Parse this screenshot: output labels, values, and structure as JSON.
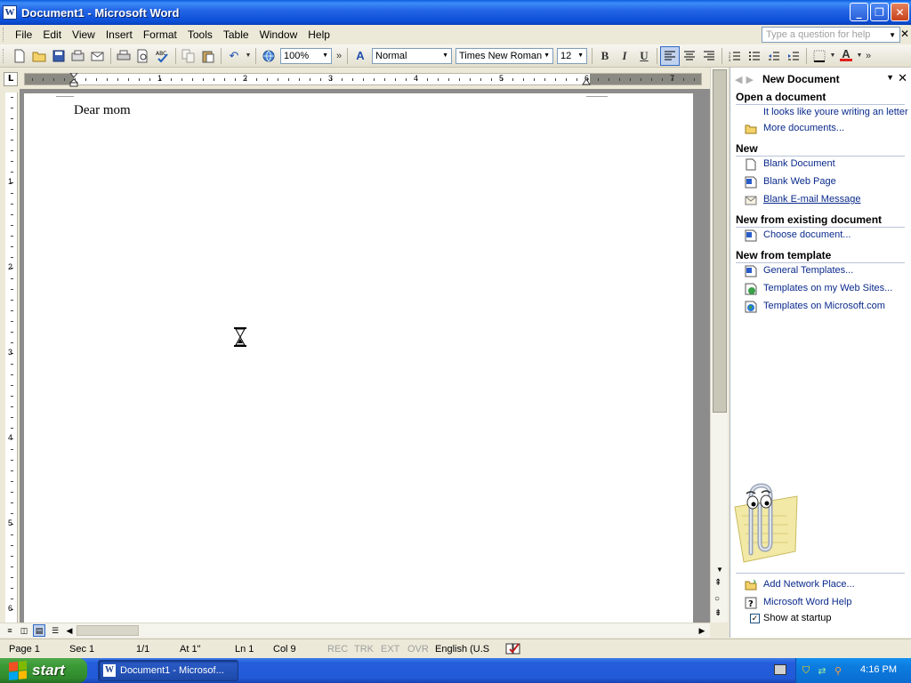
{
  "window": {
    "title": "Document1 - Microsoft Word",
    "app_icon": "W",
    "controls": {
      "minimize": "_",
      "maximize": "❐",
      "close": "✕"
    }
  },
  "menubar": {
    "items": [
      "File",
      "Edit",
      "View",
      "Insert",
      "Format",
      "Tools",
      "Table",
      "Window",
      "Help"
    ],
    "help_placeholder": "Type a question for help",
    "close_glyph": "✕"
  },
  "toolbar": {
    "zoom": "100%",
    "style": "Normal",
    "font": "Times New Roman",
    "size": "12",
    "bold": "B",
    "italic": "I",
    "underline": "U",
    "more": "»",
    "font_color": "#e0201b",
    "style_icon": "A"
  },
  "ruler": {
    "corner": "L",
    "h_numbers": [
      "1",
      "2",
      "3",
      "4",
      "5",
      "6",
      "7"
    ],
    "v_numbers": [
      "1",
      "2",
      "3",
      "4",
      "5",
      "6"
    ]
  },
  "document": {
    "text": "Dear mom"
  },
  "taskpane": {
    "title": "New Document",
    "nav_back": "◀",
    "nav_forward": "▶",
    "dropdown": "▼",
    "close": "✕",
    "sections": [
      {
        "heading": "Open a document",
        "items": [
          {
            "label": "It looks like youre writing an letter",
            "icon": "none"
          },
          {
            "label": "More documents...",
            "icon": "folder-icon"
          }
        ]
      },
      {
        "heading": "New",
        "items": [
          {
            "label": "Blank Document",
            "icon": "document-icon"
          },
          {
            "label": "Blank Web Page",
            "icon": "web-page-icon"
          },
          {
            "label": "Blank E-mail Message",
            "icon": "email-icon"
          }
        ]
      },
      {
        "heading": "New from existing document",
        "items": [
          {
            "label": "Choose document...",
            "icon": "document-icon"
          }
        ]
      },
      {
        "heading": "New from template",
        "items": [
          {
            "label": "General Templates...",
            "icon": "template-icon"
          },
          {
            "label": "Templates on my Web Sites...",
            "icon": "web-template-icon"
          },
          {
            "label": "Templates on Microsoft.com",
            "icon": "globe-icon"
          }
        ]
      }
    ],
    "footer": {
      "add_network_place": "Add Network Place...",
      "word_help": "Microsoft Word Help",
      "show_at_startup": "Show at startup",
      "show_at_startup_checked": true
    }
  },
  "statusbar": {
    "page": "Page 1",
    "sec": "Sec 1",
    "pages": "1/1",
    "at": "At 1\"",
    "ln": "Ln 1",
    "col": "Col 9",
    "rec": "REC",
    "trk": "TRK",
    "ext": "EXT",
    "ovr": "OVR",
    "language": "English (U.S"
  },
  "taskbar": {
    "start_label": "start",
    "task_label": "Document1 - Microsof...",
    "clock": "4:16 PM"
  }
}
